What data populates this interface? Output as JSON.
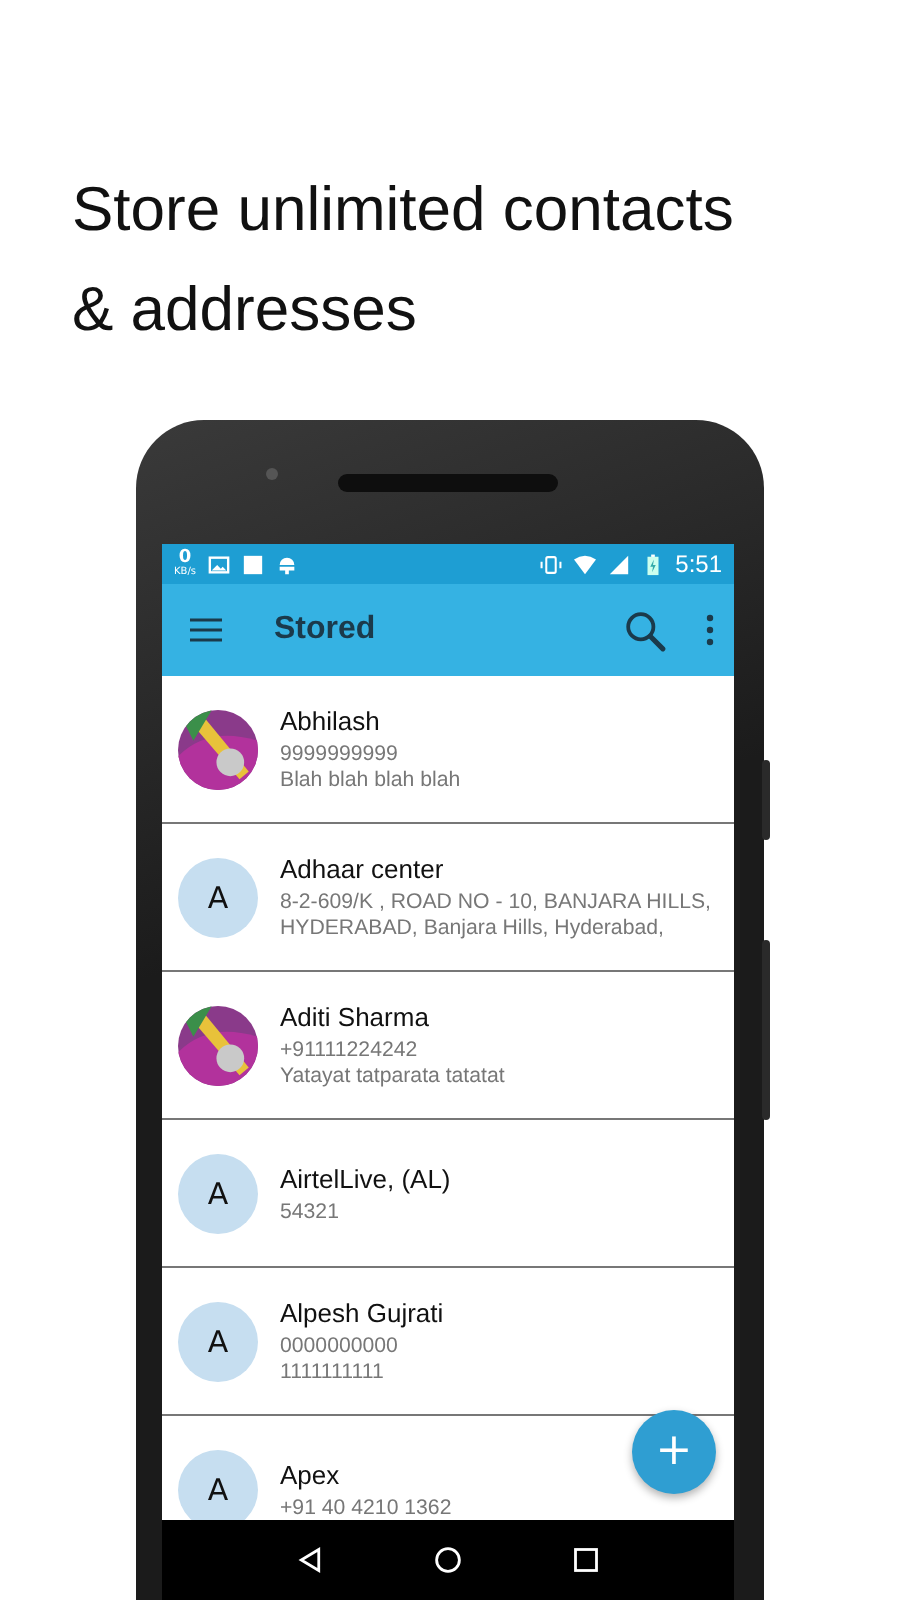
{
  "headline": [
    "Store unlimited contacts",
    "& addresses"
  ],
  "status_bar": {
    "speed": "0",
    "speed_unit": "KB/s",
    "time": "5:51"
  },
  "toolbar": {
    "title": "Stored"
  },
  "contacts": [
    {
      "name": "Abhilash",
      "lines": [
        "9999999999",
        "Blah blah blah blah"
      ]
    },
    {
      "name": "Adhaar center",
      "avatar": {
        "kind": "letter",
        "letter": "A"
      },
      "lines": [
        "8-2-609/K , ROAD NO - 10, BANJARA HILLS,",
        "HYDERABAD, Banjara Hills, Hyderabad,"
      ]
    },
    {
      "name": "Aditi Sharma",
      "lines": [
        "+91111224242",
        "Yatayat tatparata tatatat"
      ]
    },
    {
      "name": "AirtelLive, (AL)",
      "avatar": {
        "kind": "letter",
        "letter": "A"
      },
      "lines": [
        "54321"
      ]
    },
    {
      "name": "Alpesh Gujrati",
      "avatar": {
        "kind": "letter",
        "letter": "A"
      },
      "lines": [
        "0000000000",
        "1111111111"
      ]
    },
    {
      "name": "Apex",
      "avatar": {
        "kind": "letter",
        "letter": "A"
      },
      "lines": [
        "+91 40 4210 1362"
      ]
    }
  ],
  "fab": {
    "label": "+"
  }
}
